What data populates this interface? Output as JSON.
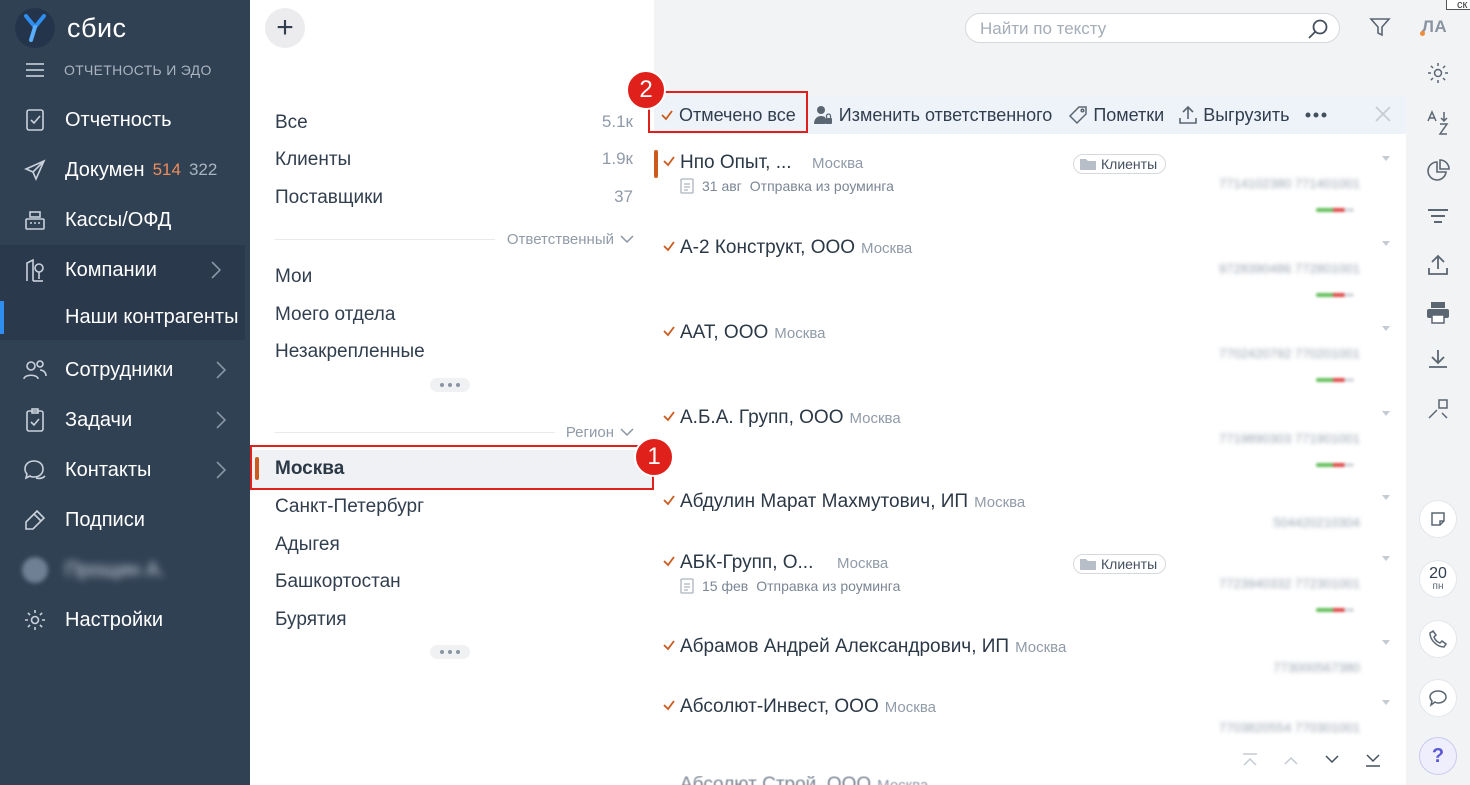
{
  "app": {
    "brand": "сбис",
    "section": "ОТЧЕТНОСТЬ И ЭДО",
    "corner_tip": "ск"
  },
  "sidebar": {
    "items": [
      {
        "label": "Отчетность",
        "icon": "report-icon"
      },
      {
        "label": "Докумен",
        "badge_new": "514",
        "badge_total": "322",
        "icon": "send-icon"
      },
      {
        "label": "Кассы/ОФД",
        "icon": "cash-register-icon"
      },
      {
        "label": "Компании",
        "icon": "company-icon",
        "active": true
      },
      {
        "label": "Наши контрагенты",
        "sub": true
      },
      {
        "label": "Сотрудники",
        "icon": "employees-icon"
      },
      {
        "label": "Задачи",
        "icon": "tasks-icon"
      },
      {
        "label": "Контакты",
        "icon": "contacts-icon"
      },
      {
        "label": "Подписи",
        "icon": "signature-icon"
      },
      {
        "label": "Прощин А.",
        "icon": "avatar",
        "blurred": true
      },
      {
        "label": "Настройки",
        "icon": "gear-icon"
      }
    ]
  },
  "filters": {
    "groups": [
      {
        "label": "Все",
        "count": "5.1к"
      },
      {
        "label": "Клиенты",
        "count": "1.9к"
      },
      {
        "label": "Поставщики",
        "count": "37"
      }
    ],
    "responsible_header": "Ответственный",
    "responsible": [
      "Мои",
      "Моего отдела",
      "Незакрепленные"
    ],
    "region_header": "Регион",
    "selected_region": "Москва",
    "regions": [
      "Санкт-Петербург",
      "Адыгея",
      "Башкортостан",
      "Бурятия"
    ]
  },
  "search": {
    "placeholder": "Найти по тексту"
  },
  "toolbar": {
    "mark_all": "Отмечено все",
    "change_responsible": "Изменить ответственного",
    "marks": "Пометки",
    "export": "Выгрузить"
  },
  "rows": [
    {
      "name": "Нпо Опыт, ...",
      "city": "Москва",
      "tag": "Клиенты",
      "date": "31 авг",
      "note": "Отправка из роуминга",
      "blur": "7714102380 771401001"
    },
    {
      "name": "А-2 Конструкт, ООО",
      "city": "Москва",
      "blur": "9728390486 772801001"
    },
    {
      "name": "ААТ, ООО",
      "city": "Москва",
      "blur": "7702420792 770201001"
    },
    {
      "name": "А.Б.А. Групп, ООО",
      "city": "Москва",
      "blur": "7719890303 771901001"
    },
    {
      "name": "Абдулин Марат Махмутович, ИП",
      "city": "Москва",
      "blur": "504420210304"
    },
    {
      "name": "АБК-Групп, О...",
      "city": "Москва",
      "tag": "Клиенты",
      "date": "15 фев",
      "note": "Отправка из роуминга",
      "blur": "7723940332 772301001"
    },
    {
      "name": "Абрамов Андрей Александрович, ИП",
      "city": "Москва",
      "blur": "773000567380"
    },
    {
      "name": "Абсолют-Инвест, ООО",
      "city": "Москва",
      "blur": "7703820554 770301001"
    },
    {
      "name": "Абсолют Строй, ООО",
      "city": "Москва"
    }
  ],
  "right_toolbar": {
    "initials": "ЛА",
    "date_day": "20",
    "date_weekday": "пн",
    "help": "?"
  },
  "annotations": {
    "marker1": "1",
    "marker2": "2"
  }
}
